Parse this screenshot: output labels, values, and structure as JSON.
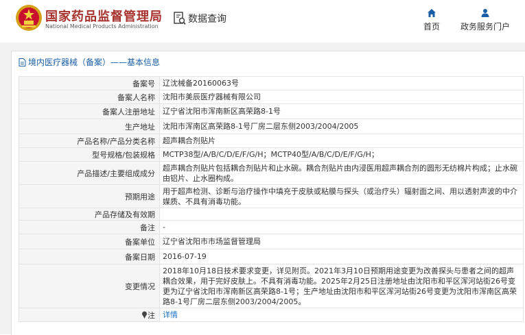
{
  "header": {
    "logo_cn": "国家药品监督管理局",
    "logo_en": "National Medical Products Administration",
    "query_label": "数据查询",
    "nav": [
      {
        "label": "首页",
        "icon": "home-icon"
      },
      {
        "label": "政务服务门户",
        "icon": "user-icon"
      }
    ]
  },
  "panel": {
    "title": "境内医疗器械（备案）——基本信息"
  },
  "rows": [
    {
      "key": "备案号",
      "value": "辽沈械备20160063号"
    },
    {
      "key": "备案人名称",
      "value": "沈阳市美辰医疗器械有限公司"
    },
    {
      "key": "备案人注册地址",
      "value": "辽宁省沈阳市浑南新区高荣路8-1号"
    },
    {
      "key": "生产地址",
      "value": "沈阳市浑南区高荣路8-1号厂房二层东侧2003/2004/2005"
    },
    {
      "key": "产品名称/产品分类名称",
      "value": "超声耦合剂贴片"
    },
    {
      "key": "型号规格/包装规格",
      "value": "MCTP38型/A/B/C/D/E/F/G/H；MCTP40型/A/B/C/D/E/F/G/H；"
    },
    {
      "key": "产品描述/主要组成成分",
      "value": "超声耦合剂贴片包括耦合剂贴片和止水碗。耦合剂贴片由内浸医用超声耦合剂的圆形无纺棉片构成；止水碗由铝片、止水圈构成。"
    },
    {
      "key": "预期用途",
      "value": "用于超声检测、诊断与治疗操作中填充于皮肤或粘膜与探头（或治疗头）辐射面之间、用以透射声波的中介媒质、不具有消毒功能。"
    },
    {
      "key": "产品存储及有效期",
      "value": ""
    },
    {
      "key": "备注",
      "value": "-"
    },
    {
      "key": "备案单位",
      "value": "辽宁省沈阳市市场监督管理局"
    },
    {
      "key": "备案日期",
      "value": "2016-07-19"
    },
    {
      "key": "变更情况",
      "value": "2018年10月18日技术要求变更，详见附页。2021年3月10日预期用途变更为改善探头与患者之间的超声耦合效果，用于完好皮肤上。不具有消毒功能。2025年2月25日注册地址由沈阳市和平区浑河站街26号变更为辽宁省沈阳市浑南新区高荣路8-1号；生产地址由沈阳市和平区浑河站街26号变更为沈阳市浑南区高荣路8-1号厂房二层东侧2003/2004/2005。"
    },
    {
      "key": "注",
      "value": "详情",
      "key_icon": "pin-icon"
    }
  ],
  "colors": {
    "brand_red": "#a7312c",
    "link_blue": "#1a73c7",
    "title_blue": "#1a5fa8"
  }
}
